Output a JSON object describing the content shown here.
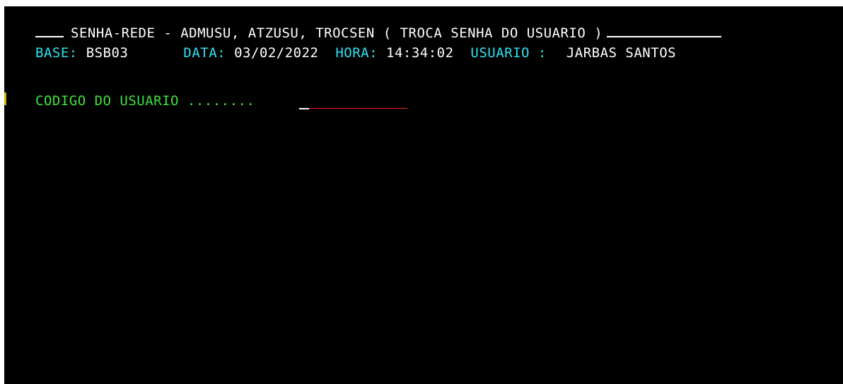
{
  "screen": {
    "title": "SENHA-REDE - ADMUSU, ATZUSU, TROCSEN ( TROCA SENHA DO USUARIO )",
    "status": {
      "base_label": "BASE:",
      "base_value": "BSB03",
      "data_label": "DATA:",
      "data_value": "03/02/2022",
      "hora_label": "HORA:",
      "hora_value": "14:34:02",
      "usuario_label": "USUARIO :",
      "usuario_value": "JARBAS SANTOS"
    },
    "field": {
      "label": "CODIGO DO USUARIO ........",
      "value": ""
    }
  },
  "colors": {
    "background": "#000000",
    "label": "#2fe2f0",
    "value": "#ffffff",
    "field_label": "#3ee43e",
    "input_underline": "#ff1a1a"
  }
}
